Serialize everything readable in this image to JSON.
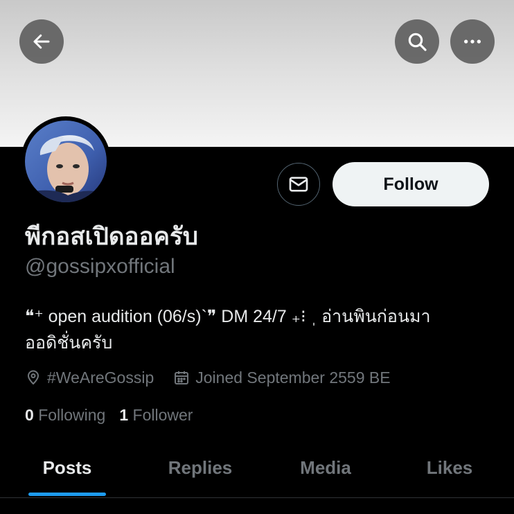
{
  "profile": {
    "display_name": "พีกอสเปิดออครับ",
    "handle": "@gossipxofficial",
    "bio_line1": "❝⁺ open audition (06/s)`❞ DM 24/7 ₊⁝ ˌ อ่านพินก่อนมา",
    "bio_line2": "ออดิชั่นครับ",
    "location": "#WeAreGossip",
    "joined": "Joined September 2559 BE",
    "following_count": "0",
    "following_label": "Following",
    "follower_count": "1",
    "follower_label": "Follower"
  },
  "actions": {
    "follow_label": "Follow"
  },
  "tabs": [
    {
      "label": "Posts",
      "active": true
    },
    {
      "label": "Replies",
      "active": false
    },
    {
      "label": "Media",
      "active": false
    },
    {
      "label": "Likes",
      "active": false
    }
  ],
  "icons": {
    "back": "arrow-left-icon",
    "search": "search-icon",
    "more": "more-dots-icon",
    "message": "envelope-icon",
    "location": "location-pin-icon",
    "calendar": "calendar-icon"
  },
  "colors": {
    "background": "#000000",
    "text_primary": "#e7e9ea",
    "text_secondary": "#71767b",
    "accent": "#1d9bf0",
    "follow_button_bg": "#eff3f4"
  }
}
